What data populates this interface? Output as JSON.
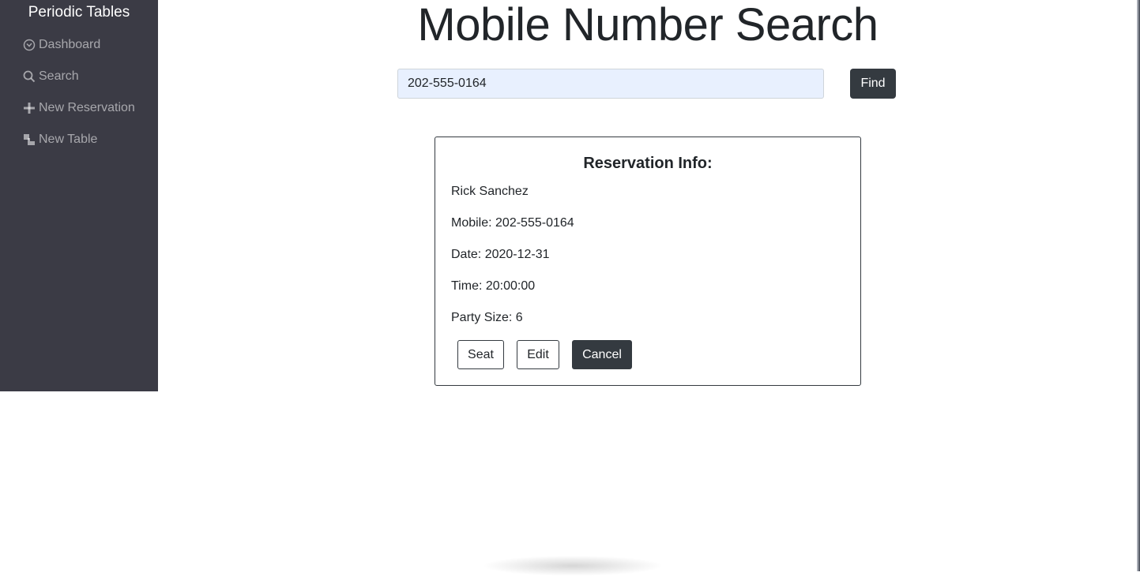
{
  "sidebar": {
    "brand": "Periodic Tables",
    "items": [
      {
        "label": "Dashboard",
        "icon": "dashboard-icon"
      },
      {
        "label": "Search",
        "icon": "search-icon"
      },
      {
        "label": "New Reservation",
        "icon": "plus-icon"
      },
      {
        "label": "New Table",
        "icon": "tables-icon"
      }
    ]
  },
  "main": {
    "title": "Mobile Number Search",
    "search_value": "202-555-0164",
    "find_label": "Find"
  },
  "reservation": {
    "heading": "Reservation Info:",
    "name": "Rick Sanchez",
    "mobile": "Mobile: 202-555-0164",
    "date": "Date: 2020-12-31",
    "time": "Time: 20:00:00",
    "party_size": "Party Size: 6",
    "seat_label": "Seat",
    "edit_label": "Edit",
    "cancel_label": "Cancel"
  },
  "colors": {
    "sidebar_bg": "#3b3b45",
    "dark_button": "#343a40",
    "input_bg": "#e8f0fe"
  }
}
